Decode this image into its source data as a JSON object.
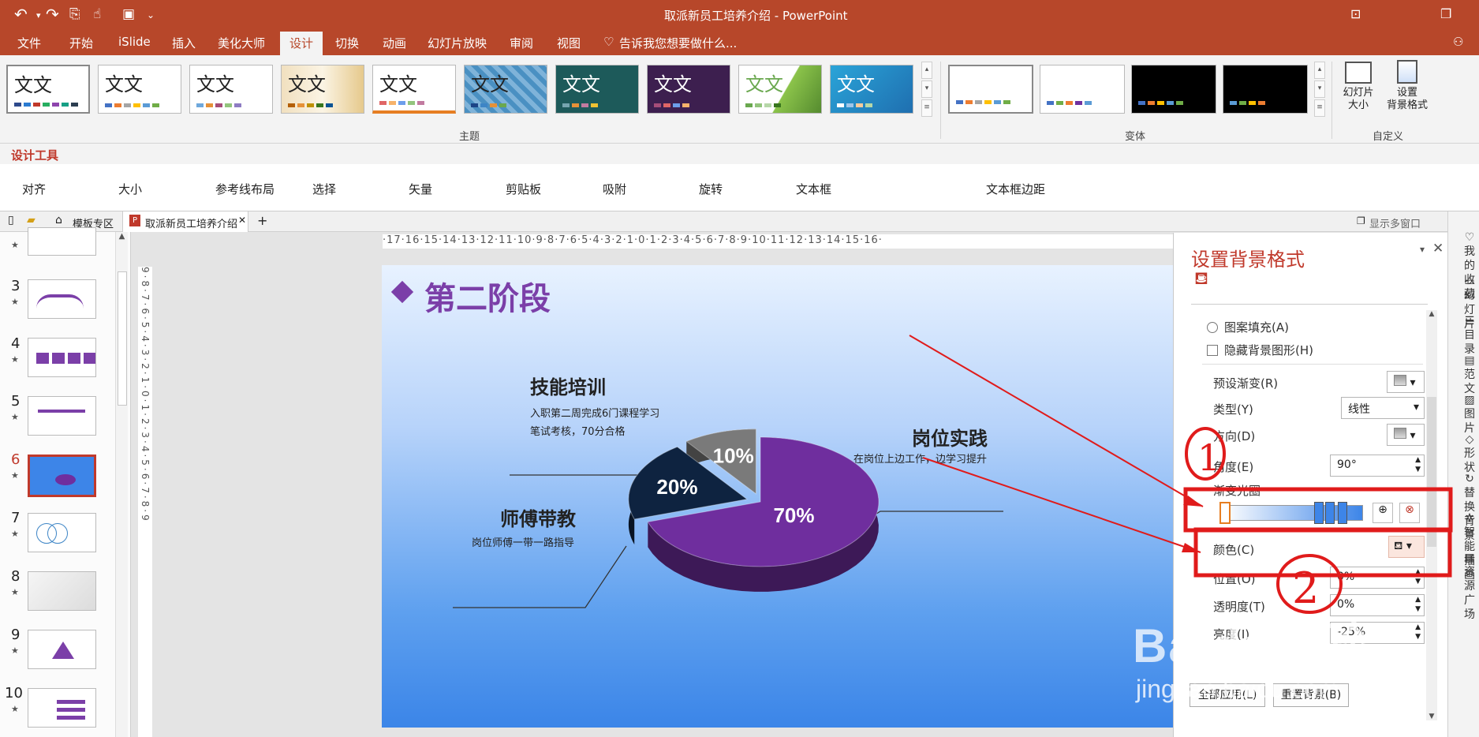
{
  "titlebar": {
    "title": "取派新员工培养介绍 - PowerPoint"
  },
  "menu": [
    "文件",
    "开始",
    "iSlide",
    "插入",
    "美化大师",
    "设计",
    "切换",
    "动画",
    "幻灯片放映",
    "审阅",
    "视图"
  ],
  "menu_active": "设计",
  "tell_me": "告诉我您想要做什么...",
  "ribbon": {
    "theme_text": "文文",
    "group_themes": "主题",
    "group_variants": "变体",
    "group_custom": "自定义",
    "slide_size_label": "幻灯片\n大小",
    "format_bg_label": "设置\n背景格式"
  },
  "design_tools": "设计工具",
  "tools": [
    "对齐",
    "大小",
    "参考线布局",
    "选择",
    "矢量",
    "剪贴板",
    "吸附",
    "旋转",
    "文本框",
    "文本框边距"
  ],
  "tabs": {
    "template": "模板专区",
    "document": "取派新员工培养介绍",
    "multi_window": "显示多窗口"
  },
  "hruler_text": "·17·16·15·14·13·12·11·10·9·8·7·6·5·4·3·2·1·0·1·2·3·4·5·6·7·8·9·10·11·12·13·14·15·16·",
  "vruler_text": "9·8·7·6·5·4·3·2·1·0·1·2·3·4·5·6·7·8·9",
  "thumbnails": [
    {
      "num": "3"
    },
    {
      "num": "4"
    },
    {
      "num": "5"
    },
    {
      "num": "6"
    },
    {
      "num": "7"
    },
    {
      "num": "8"
    },
    {
      "num": "9"
    },
    {
      "num": "10"
    }
  ],
  "slide": {
    "title": "第二阶段",
    "skill": {
      "heading": "技能培训",
      "line1": "入职第二周完成6门课程学习",
      "line2": "笔试考核，70分合格"
    },
    "post": {
      "heading": "岗位实践",
      "line1": "在岗位上边工作，边学习提升"
    },
    "mentor": {
      "heading": "师傅带教",
      "line1": "岗位师傅一带一路指导"
    }
  },
  "chart_data": {
    "type": "pie",
    "slices": [
      {
        "label": "岗位实践",
        "value": 70,
        "text": "70%",
        "color": "#6f2e9e"
      },
      {
        "label": "师傅带教",
        "value": 20,
        "text": "20%",
        "color": "#0e2340"
      },
      {
        "label": "技能培训",
        "value": 10,
        "text": "10%",
        "color": "#7a7a7a"
      }
    ]
  },
  "panel": {
    "title": "设置背景格式",
    "pattern_fill": "图案填充(A)",
    "hide_bg": "隐藏背景图形(H)",
    "preset_gradient": "预设渐变(R)",
    "type_label": "类型(Y)",
    "type_value": "线性",
    "direction": "方向(D)",
    "angle_label": "角度(E)",
    "angle_value": "90°",
    "gradient_stops": "渐变光圈",
    "color_label": "颜色(C)",
    "position_label": "位置(O)",
    "position_value": "0%",
    "transparency_label": "透明度(T)",
    "transparency_value": "0%",
    "brightness_label": "亮度(I)",
    "brightness_value": "-25%",
    "apply_all": "全部应用(L)",
    "reset_bg": "重置背景(B)"
  },
  "annotations": {
    "mark1": "1",
    "mark2": "2"
  },
  "watermark": {
    "logo": "Baidu经验",
    "url": "jingyan.baidu.com"
  },
  "right_strip": [
    "我的收藏",
    "幻灯片",
    "目录",
    "范文",
    "图片",
    "形状",
    "替换背景",
    "智能插画",
    "资源广场"
  ]
}
